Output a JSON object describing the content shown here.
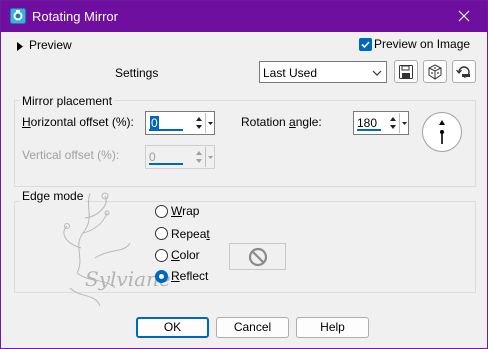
{
  "window": {
    "title": "Rotating Mirror",
    "icon": "psp-app-icon"
  },
  "header": {
    "preview_label": "Preview",
    "preview_on_image_label": "Preview on Image",
    "preview_on_image_checked": true,
    "settings_label": "Settings",
    "settings_value": "Last Used",
    "icons": [
      "save-preset-icon",
      "randomize-icon",
      "reset-icon"
    ]
  },
  "mirror_placement": {
    "title": "Mirror placement",
    "horizontal_label_pre": "H",
    "horizontal_label_post": "orizontal offset (%):",
    "horizontal_value": "0",
    "vertical_label": "Vertical offset (%):",
    "vertical_value": "0",
    "rotation_label_pre": "Rotation ",
    "rotation_label_u": "a",
    "rotation_label_post": "ngle:",
    "rotation_value": "180"
  },
  "edge_mode": {
    "title": "Edge mode",
    "options": [
      {
        "u": "W",
        "rest": "rap",
        "selected": false
      },
      {
        "pre": "Repea",
        "u": "t",
        "rest": "",
        "selected": false
      },
      {
        "u": "C",
        "rest": "olor",
        "selected": false
      },
      {
        "u": "R",
        "rest": "eflect",
        "selected": true
      }
    ],
    "watermark_text": "Sylviane"
  },
  "footer": {
    "ok": "OK",
    "cancel": "Cancel",
    "help": "Help"
  },
  "colors": {
    "titlebar": "#6f0f9f",
    "accent": "#0067c0"
  }
}
